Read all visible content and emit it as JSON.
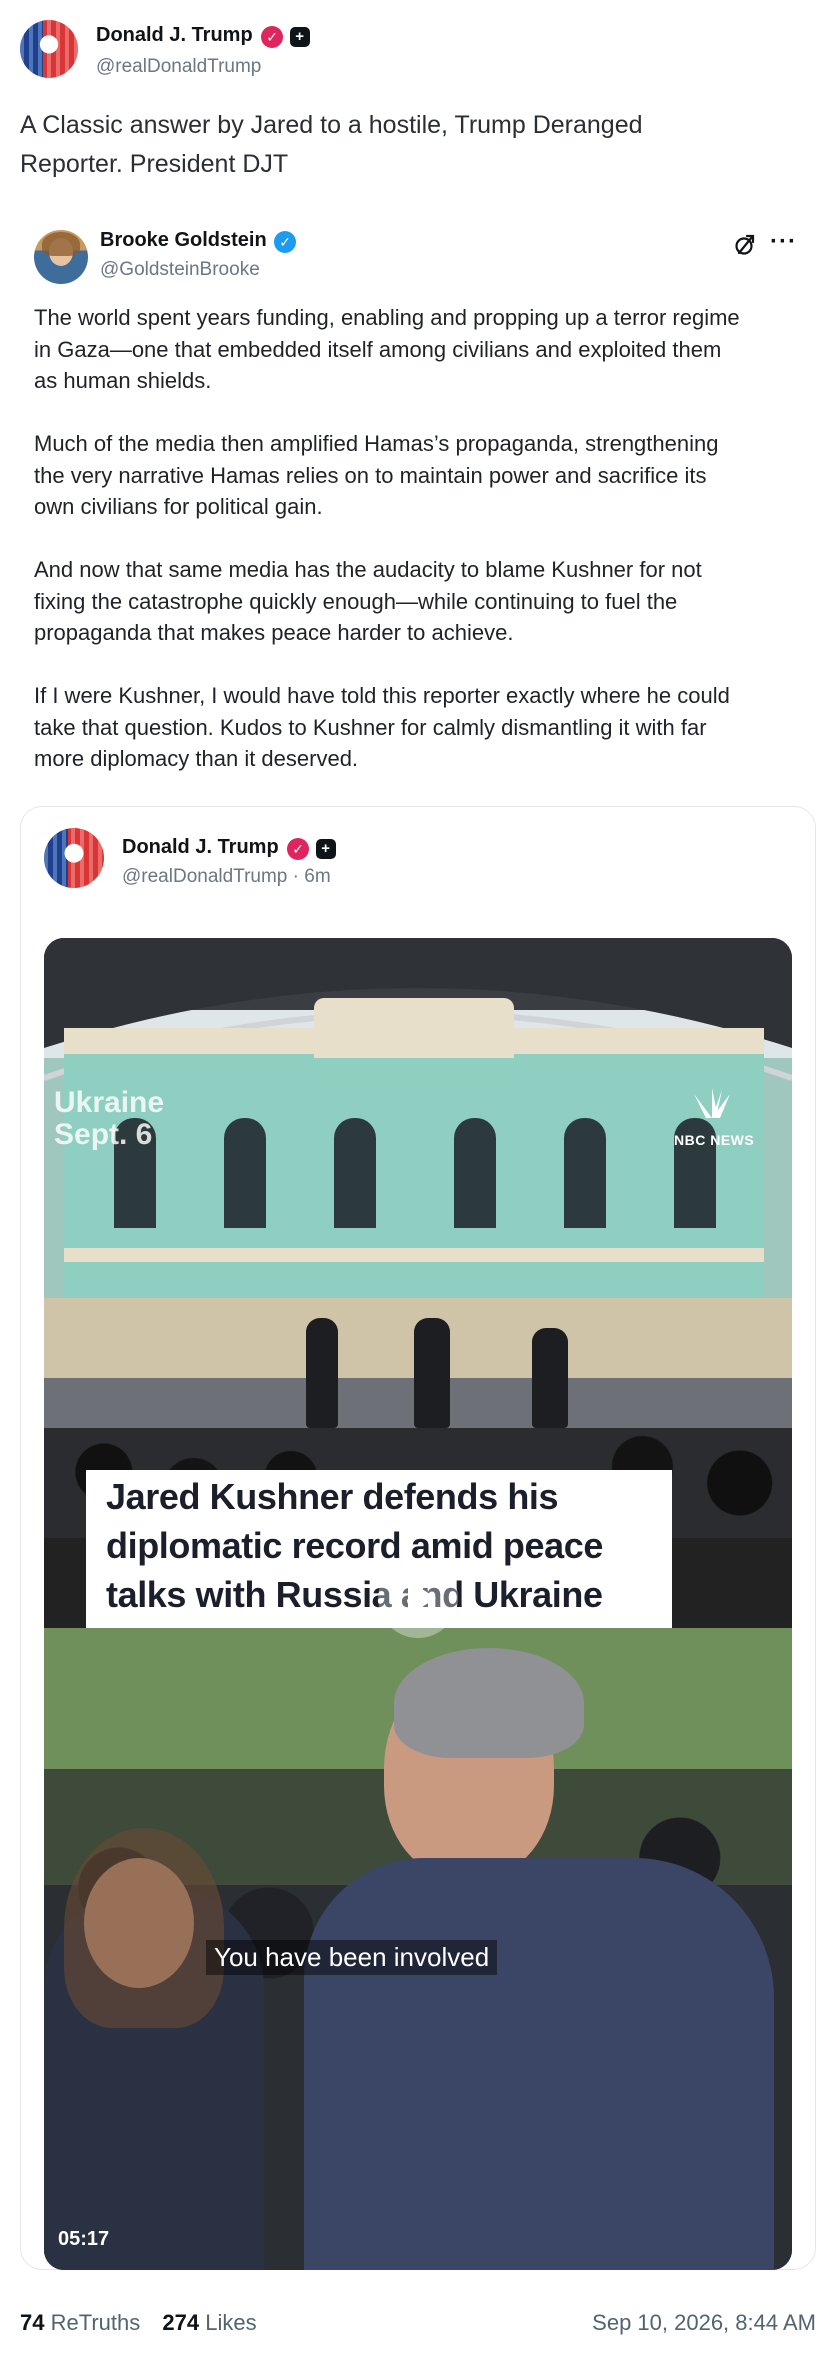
{
  "post": {
    "author_name": "Donald J. Trump",
    "author_handle": "@realDonaldTrump",
    "text_line1": "A Classic answer by Jared to a hostile, Trump Deranged",
    "text_line2": "Reporter. President DJT"
  },
  "quoted": {
    "author_name": "Brooke Goldstein",
    "author_handle": "@GoldsteinBrooke",
    "more_icon_label": "···",
    "paragraphs": [
      [
        "The world spent years funding, enabling and propping up a terror regime",
        "in Gaza—one that embedded itself among civilians and exploited them",
        "as human shields."
      ],
      [
        "Much of the media then amplified Hamas’s propaganda, strengthening",
        "the very narrative Hamas relies on to maintain power and sacrifice its",
        "own civilians for political gain."
      ],
      [
        "And now that same media has the audacity to blame Kushner for not",
        "fixing the catastrophe quickly enough—while continuing to fuel the",
        "propaganda that makes peace harder to achieve."
      ],
      [
        "If I were Kushner, I would have told this reporter exactly where he could",
        "take that question. Kudos to Kushner for calmly dismantling it with far",
        "more diplomacy than it deserved."
      ]
    ]
  },
  "embedded": {
    "author_name": "Donald J. Trump",
    "author_handle": "@realDonaldTrump · 6m",
    "video": {
      "location": "Ukraine",
      "date": "Sept. 6",
      "network": "NBC NEWS",
      "headline_line1": "Jared Kushner defends his",
      "headline_line2": "diplomatic record amid peace",
      "headline_line3": "talks with Russia and Ukraine",
      "subtitle": "You have been involved",
      "duration": "05:17"
    }
  },
  "footer": {
    "retruths_count": "74",
    "retruths_label": "ReTruths",
    "likes_count": "274",
    "likes_label": "Likes",
    "timestamp": "Sep 10, 2026, 8:44 AM"
  },
  "colors": {
    "verified_red": "#e0245e",
    "verified_blue": "#1d9bf0",
    "text_primary": "#0f1419",
    "text_secondary": "#6b7785"
  },
  "icons": [
    "verified-badge-icon",
    "affiliate-badge-icon",
    "share-icon",
    "more-icon",
    "play-icon",
    "nbc-peacock-icon"
  ]
}
